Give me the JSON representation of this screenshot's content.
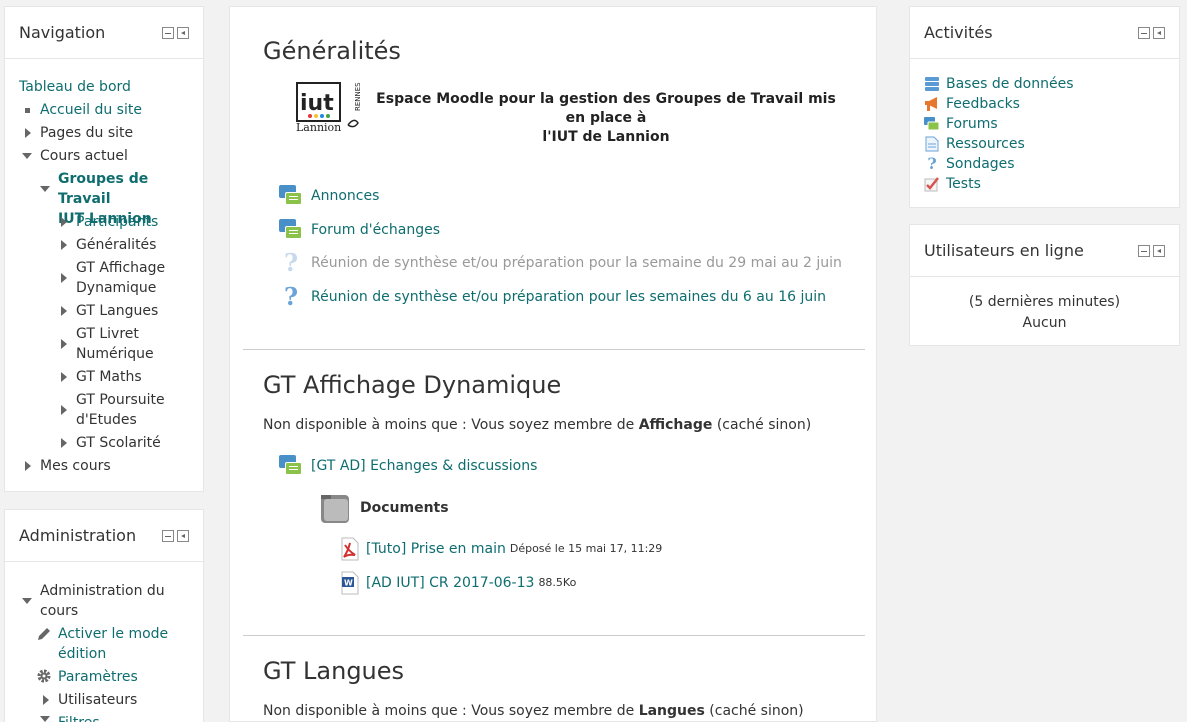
{
  "navigation": {
    "title": "Navigation",
    "dashboard": "Tableau de bord",
    "site_home": "Accueil du site",
    "site_pages": "Pages du site",
    "current_course": "Cours actuel",
    "course_name": "Groupes de Travail IUT Lannion",
    "course_name_line1": "Groupes de Travail",
    "course_name_line2": "IUT Lannion",
    "items": [
      {
        "label": "Participants",
        "link": true
      },
      {
        "label": "Généralités",
        "link": false
      },
      {
        "label": "GT Affichage Dynamique",
        "line1": "GT Affichage",
        "line2": "Dynamique",
        "link": false
      },
      {
        "label": "GT Langues",
        "link": false
      },
      {
        "label": "GT Livret Numérique",
        "line1": "GT Livret",
        "line2": "Numérique",
        "link": false
      },
      {
        "label": "GT Maths",
        "link": false
      },
      {
        "label": "GT Poursuite d'Etudes",
        "line1": "GT Poursuite",
        "line2": "d'Etudes",
        "link": false
      },
      {
        "label": "GT Scolarité",
        "link": false
      }
    ],
    "my_courses": "Mes cours"
  },
  "administration": {
    "title": "Administration",
    "course_admin_line1": "Administration du",
    "course_admin_line2": "cours",
    "edit_mode_line1": "Activer le mode",
    "edit_mode_line2": "édition",
    "settings": "Paramètres",
    "users": "Utilisateurs",
    "filters": "Filtres"
  },
  "main": {
    "sections": [
      {
        "title": "Généralités",
        "banner_line1": "Espace Moodle pour la gestion des Groupes de Travail mis en place à",
        "banner_line2": "l'IUT de Lannion",
        "logo_text": "iut",
        "logo_city": "Lannion",
        "logo_side": "RENNES",
        "activities": [
          {
            "label": "Annonces",
            "icon": "forum-icon",
            "dimmed": false
          },
          {
            "label": "Forum d'échanges",
            "icon": "forum-icon",
            "dimmed": false
          },
          {
            "label": "Réunion de synthèse et/ou préparation pour la semaine du 29 mai au 2 juin",
            "icon": "question-icon",
            "dimmed": true
          },
          {
            "label": "Réunion de synthèse et/ou préparation pour les semaines du 6 au 16 juin",
            "icon": "question-icon",
            "dimmed": false
          }
        ]
      },
      {
        "title": "GT Affichage Dynamique",
        "restriction_prefix": "Non disponible à moins que : Vous soyez membre de ",
        "restriction_group": "Affichage",
        "restriction_suffix": " (caché sinon)",
        "forum": "[GT AD] Echanges & discussions",
        "folder": "Documents",
        "files": [
          {
            "label": "[Tuto] Prise en main",
            "meta": "Déposé le 15 mai 17, 11:29",
            "icon": "pdf-icon"
          },
          {
            "label": "[AD IUT] CR 2017-06-13",
            "meta": "88.5Ko",
            "icon": "word-icon"
          }
        ]
      },
      {
        "title": "GT Langues",
        "restriction_prefix": "Non disponible à moins que : Vous soyez membre de ",
        "restriction_group": "Langues",
        "restriction_suffix": " (caché sinon)"
      }
    ]
  },
  "activities_block": {
    "title": "Activités",
    "items": [
      {
        "label": "Bases de données",
        "icon": "database-icon",
        "color": "#5b9bd5"
      },
      {
        "label": "Feedbacks",
        "icon": "megaphone-icon",
        "color": "#e8772e"
      },
      {
        "label": "Forums",
        "icon": "forum-icon",
        "color": "#6aaa3a"
      },
      {
        "label": "Ressources",
        "icon": "file-icon",
        "color": "#6aa3d8"
      },
      {
        "label": "Sondages",
        "icon": "question-icon",
        "color": "#6aa3d8"
      },
      {
        "label": "Tests",
        "icon": "quiz-icon",
        "color": "#d9534f"
      }
    ]
  },
  "online_users": {
    "title": "Utilisateurs en ligne",
    "period": "(5 dernières minutes)",
    "none": "Aucun"
  },
  "colors": {
    "link": "#0f6d6f",
    "text": "#333333",
    "dimmed": "#999999",
    "background": "#f2f2f2"
  }
}
